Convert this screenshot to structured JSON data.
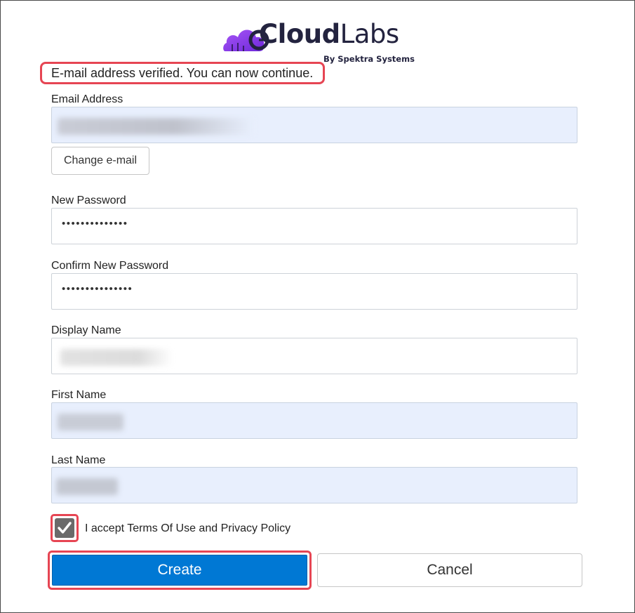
{
  "brand": {
    "name_bold": "Cloud",
    "name_regular": "Labs",
    "byline": "By Spektra Systems",
    "logo_color": "#7c3aed"
  },
  "status_message": "E-mail address verified. You can now continue.",
  "form": {
    "email": {
      "label": "Email Address",
      "value_redacted": true
    },
    "change_email_button": "Change e-mail",
    "new_password": {
      "label": "New Password",
      "value": "••••••••••••••"
    },
    "confirm_password": {
      "label": "Confirm New Password",
      "value": "•••••••••••••••"
    },
    "display_name": {
      "label": "Display Name",
      "value_redacted": true
    },
    "first_name": {
      "label": "First Name",
      "value_redacted": true
    },
    "last_name": {
      "label": "Last Name",
      "value_redacted": true
    },
    "terms": {
      "label": "I accept Terms Of Use and Privacy Policy",
      "checked": true
    }
  },
  "actions": {
    "create": "Create",
    "cancel": "Cancel"
  },
  "colors": {
    "highlight": "#e64553",
    "primary": "#0078d4",
    "autofill": "#e8effd"
  }
}
